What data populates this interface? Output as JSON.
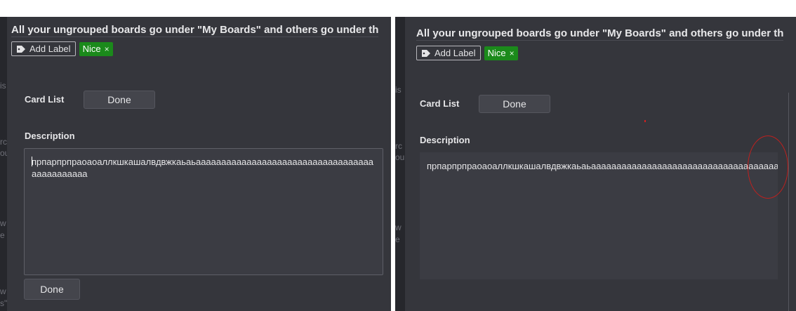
{
  "card": {
    "title": "All your ungrouped boards go under \"My Boards\" and others go under th",
    "add_label": "Add Label",
    "label_chip": "Nice",
    "label_chip_close": "×",
    "card_list_label": "Card List",
    "card_list_done": "Done",
    "description_label": "Description",
    "description_text": "прпарпрпраоаоаллкшкашалвдвжкаьаьаааааааааааааааааааааааааааааааааааааааааааааа",
    "description_done": "Done"
  },
  "background_fragments": {
    "left": [
      "is",
      "rc",
      "ou",
      "w",
      "e",
      "w",
      "s\""
    ],
    "right": [
      "is",
      "rc",
      "ou",
      "w",
      "e"
    ]
  },
  "colors": {
    "panel_bg": "#2c2d33",
    "modal_bg": "#35363c",
    "label_green": "#1b8a1b",
    "annotation_red": "#c0201e"
  },
  "icons": {
    "tag": "tag-icon",
    "close": "close-icon"
  }
}
